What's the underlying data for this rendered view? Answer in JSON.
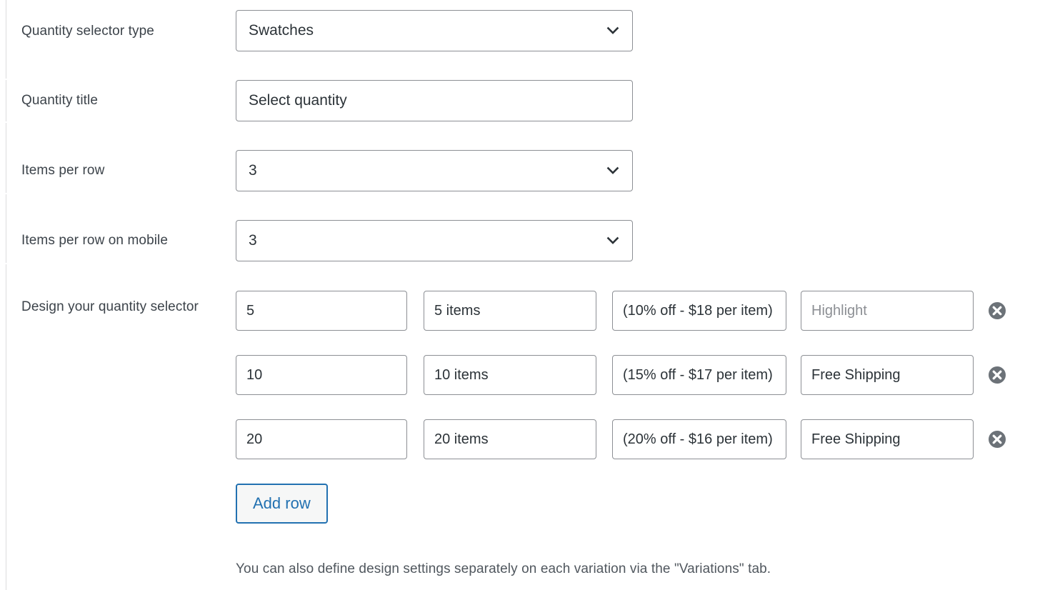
{
  "panel": {
    "edge_color": "#dcdcde"
  },
  "fields": [
    {
      "id": "quantity-selector-type",
      "label": "Quantity selector type",
      "control": "select",
      "value": "Swatches"
    },
    {
      "id": "quantity-title",
      "label": "Quantity title",
      "control": "text",
      "value": "Select quantity",
      "placeholder": ""
    },
    {
      "id": "items-per-row",
      "label": "Items per row",
      "control": "select",
      "value": "3"
    },
    {
      "id": "items-per-row-mobile",
      "label": "Items per row on mobile",
      "control": "select",
      "value": "3"
    }
  ],
  "repeater": {
    "label": "Design your quantity selector",
    "columns": [
      "quantity",
      "label",
      "description",
      "badge"
    ],
    "rows": [
      {
        "quantity": "5",
        "label": "5 items",
        "description": "(10% off - $18 per item)",
        "badge": "",
        "badge_placeholder": "Highlight",
        "remove_icon": "remove-circle-icon"
      },
      {
        "quantity": "10",
        "label": "10 items",
        "description": "(15% off - $17 per item)",
        "badge": "Free Shipping",
        "badge_placeholder": "Highlight",
        "remove_icon": "remove-circle-icon"
      },
      {
        "quantity": "20",
        "label": "20 items",
        "description": "(20% off - $16 per item)",
        "badge": "Free Shipping",
        "badge_placeholder": "Highlight",
        "remove_icon": "remove-circle-icon"
      }
    ],
    "add_row_label": "Add row"
  },
  "footer": {
    "note": "You can also define design settings separately on each variation via the \"Variations\" tab."
  },
  "colors": {
    "accent_blue": "#2271b1",
    "input_border": "#8c8f94",
    "label_text": "#3c434a",
    "value_text": "#2c3338",
    "placeholder_text": "#8c8f94",
    "remove_icon": "#6c7278",
    "add_row_bg": "#f6f7f7"
  },
  "icons": {
    "chevron": "chevron-down-icon",
    "remove": "remove-circle-icon"
  }
}
